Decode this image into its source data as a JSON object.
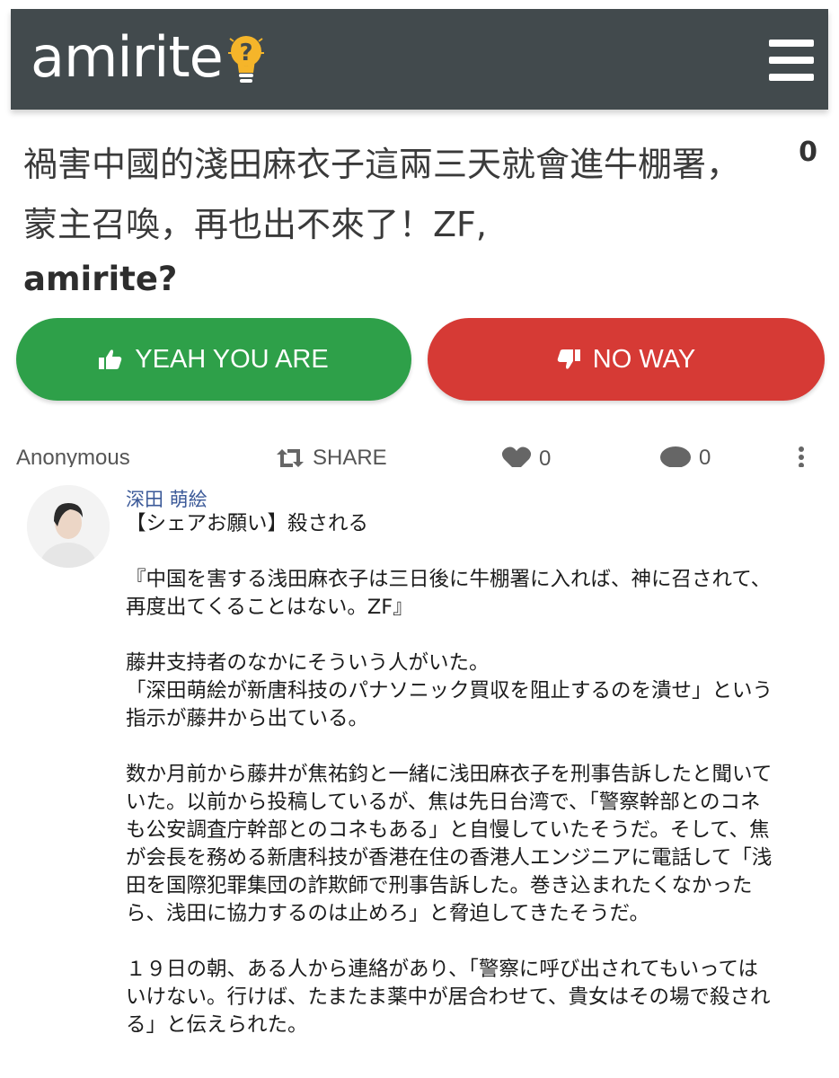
{
  "header": {
    "logo_text": "amirite",
    "menu_icon": "hamburger-menu-icon",
    "background_color": "#424a4d"
  },
  "question": {
    "text": "禍害中國的淺田麻衣子這兩三天就會進牛棚署，蒙主召喚，再也出不來了！ZF,",
    "suffix": "amirite?",
    "vote_count": "0"
  },
  "buttons": {
    "yes_label": "YEAH YOU ARE",
    "yes_icon": "thumbs-up-icon",
    "yes_color": "#2ea049",
    "no_label": "NO WAY",
    "no_icon": "thumbs-down-icon",
    "no_color": "#d63a35"
  },
  "meta": {
    "author": "Anonymous",
    "share_label": "SHARE",
    "likes_count": "0",
    "comments_count": "0"
  },
  "post": {
    "author_name": "深田 萌絵",
    "paragraphs": [
      "【シェアお願い】殺される",
      "『中国を害する浅田麻衣子は三日後に牛棚署に入れば、神に召されて、再度出てくることはない。ZF』",
      "藤井支持者のなかにそういう人がいた。\n「深田萌絵が新唐科技のパナソニック買収を阻止するのを潰せ」という指示が藤井から出ている。",
      "数か月前から藤井が焦祐鈞と一緒に浅田麻衣子を刑事告訴したと聞いていた。以前から投稿しているが、焦は先日台湾で、「警察幹部とのコネも公安調査庁幹部とのコネもある」と自慢していたそうだ。そして、焦が会長を務める新唐科技が香港在住の香港人エンジニアに電話して「浅田を国際犯罪集団の詐欺師で刑事告訴した。巻き込まれたくなかったら、浅田に協力するのは止めろ」と脅迫してきたそうだ。",
      "１９日の朝、ある人から連絡があり、「警察に呼び出されてもいってはいけない。行けば、たまたま薬中が居合わせて、貴女はその場で殺される」と伝えられた。"
    ]
  }
}
